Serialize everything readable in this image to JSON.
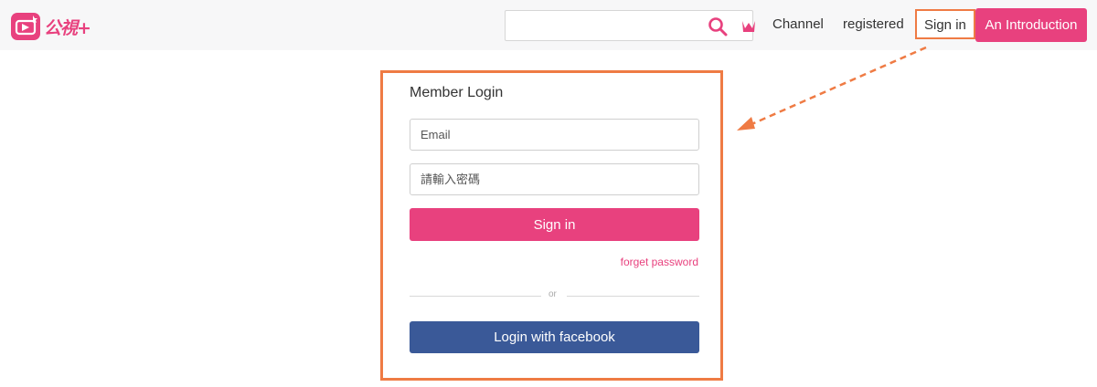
{
  "header": {
    "logo_text": "公視+",
    "search": {
      "value": "",
      "placeholder": ""
    },
    "nav": {
      "channel": "Channel",
      "registered": "registered",
      "sign_in": "Sign in",
      "introduction": "An Introduction"
    }
  },
  "login": {
    "title": "Member Login",
    "email_placeholder": "Email",
    "password_placeholder": "請輸入密碼",
    "submit_label": "Sign in",
    "forget_label": "forget password",
    "or_label": "or",
    "facebook_label": "Login with facebook"
  },
  "icons": {
    "logo": "tv-logo-icon",
    "search": "search-icon",
    "crown": "crown-icon",
    "annotation": "arrow-icon"
  },
  "colors": {
    "brand_pink": "#e8417e",
    "facebook_blue": "#3a5998",
    "annotation_orange": "#ef7b44",
    "header_bg": "#f7f7f8"
  }
}
